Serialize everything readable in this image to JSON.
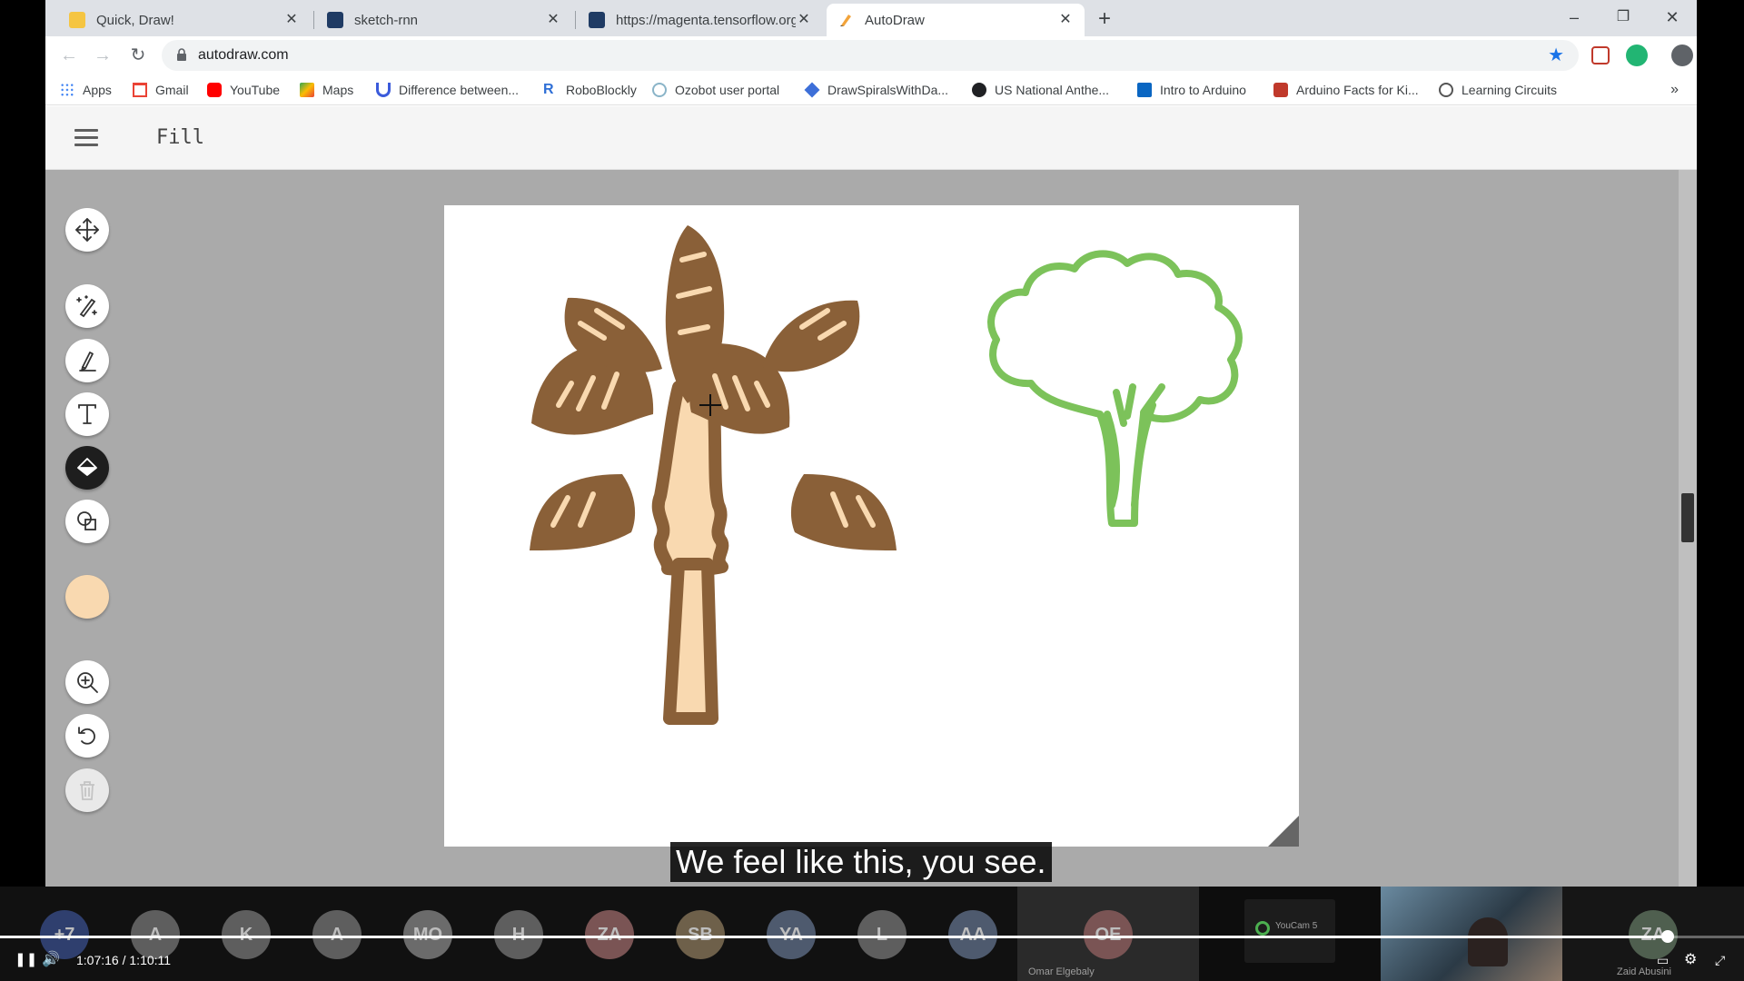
{
  "browser": {
    "tabs": [
      {
        "title": "Quick, Draw!",
        "favicon_color": "#f5c542",
        "active": false
      },
      {
        "title": "sketch-rnn",
        "favicon_color": "#1f3b64",
        "active": false
      },
      {
        "title": "https://magenta.tensorflow.org/a",
        "favicon_color": "#1f3b64",
        "active": false
      },
      {
        "title": "AutoDraw",
        "favicon_color": "#f2a33a",
        "active": true
      }
    ],
    "new_tab_symbol": "+",
    "window_controls": {
      "minimize": "–",
      "restore": "❐",
      "close": "✕"
    },
    "url": "autodraw.com",
    "bookmarks": [
      {
        "label": "Apps",
        "color": "#4285f4"
      },
      {
        "label": "Gmail",
        "color": "#ea4335"
      },
      {
        "label": "YouTube",
        "color": "#ff0000"
      },
      {
        "label": "Maps",
        "color": "#34a853"
      },
      {
        "label": "Difference between...",
        "color": "#3b5bdb"
      },
      {
        "label": "RoboBlockly",
        "color": "#2f6fd6"
      },
      {
        "label": "Ozobot user portal",
        "color": "#8ab4c8"
      },
      {
        "label": "DrawSpiralsWithDa...",
        "color": "#3d6fd8"
      },
      {
        "label": "US National Anthe...",
        "color": "#202124"
      },
      {
        "label": "Intro to Arduino",
        "color": "#0a66c2"
      },
      {
        "label": "Arduino Facts for Ki...",
        "color": "#c0392b"
      },
      {
        "label": "Learning Circuits",
        "color": "#555555"
      }
    ],
    "bookmarks_more": "»"
  },
  "app": {
    "mode_label": "Fill",
    "tools": [
      "move-icon",
      "autodraw-icon",
      "draw-icon",
      "text-icon",
      "fill-icon",
      "shape-icon"
    ],
    "selected_color": "#f9d9b0",
    "view_tools": [
      "zoom-icon",
      "undo-icon",
      "delete-icon"
    ]
  },
  "colors": {
    "palm_outline": "#8a6038",
    "palm_fill": "#f9d9b0",
    "tree_outline": "#7cc25a",
    "accent_blue": "#1a73e8"
  },
  "caption": "We feel like this, you see.",
  "call": {
    "participants": [
      {
        "initials": "+7",
        "bg": "#2f3f6e"
      },
      {
        "initials": "A",
        "bg": "#5e5e5e"
      },
      {
        "initials": "K",
        "bg": "#5e5e5e"
      },
      {
        "initials": "A",
        "bg": "#5e5e5e"
      },
      {
        "initials": "MO",
        "bg": "#6b6b6b"
      },
      {
        "initials": "H",
        "bg": "#5e5e5e"
      },
      {
        "initials": "ZA",
        "bg": "#7a5454"
      },
      {
        "initials": "SB",
        "bg": "#6e604a"
      },
      {
        "initials": "YA",
        "bg": "#4e5a6e"
      },
      {
        "initials": "L",
        "bg": "#5e5e5e"
      },
      {
        "initials": "AA",
        "bg": "#4e5a6e"
      }
    ],
    "tiles": [
      {
        "initials": "OE",
        "name": "Omar Elgebaly"
      },
      {
        "initials": "",
        "name": "YouCam 5"
      },
      {
        "initials": "",
        "name": ""
      },
      {
        "initials": "ZA",
        "name": "Zaid Abusini"
      }
    ]
  },
  "player": {
    "current_time": "1:07:16",
    "separator": "/",
    "duration": "1:10:11",
    "progress_fraction": 0.9561
  }
}
